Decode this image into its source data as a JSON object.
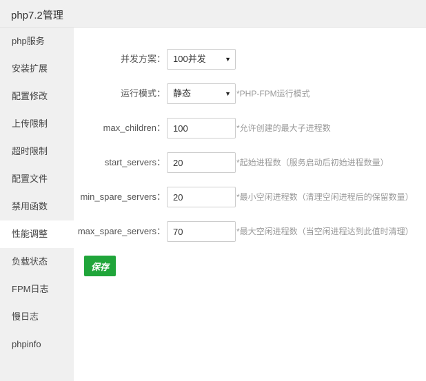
{
  "window": {
    "title": "php7.2管理"
  },
  "sidebar": {
    "items": [
      {
        "label": "php服务"
      },
      {
        "label": "安装扩展"
      },
      {
        "label": "配置修改"
      },
      {
        "label": "上传限制"
      },
      {
        "label": "超时限制"
      },
      {
        "label": "配置文件"
      },
      {
        "label": "禁用函数"
      },
      {
        "label": "性能调整",
        "active": true
      },
      {
        "label": "负载状态"
      },
      {
        "label": "FPM日志"
      },
      {
        "label": "慢日志"
      },
      {
        "label": "phpinfo"
      }
    ]
  },
  "form": {
    "concurrency": {
      "label": "并发方案：",
      "value": "100并发"
    },
    "mode": {
      "label": "运行模式：",
      "value": "静态",
      "hint": "*PHP-FPM运行模式"
    },
    "max_children": {
      "label": "max_children：",
      "value": "100",
      "hint": "*允许创建的最大子进程数"
    },
    "start_servers": {
      "label": "start_servers：",
      "value": "20",
      "hint": "*起始进程数（服务启动后初始进程数量）"
    },
    "min_spare_servers": {
      "label": "min_spare_servers：",
      "value": "20",
      "hint": "*最小空闲进程数（清理空闲进程后的保留数量）"
    },
    "max_spare_servers": {
      "label": "max_spare_servers：",
      "value": "70",
      "hint": "*最大空闲进程数（当空闲进程达到此值时清理）"
    },
    "save_label": "保存"
  },
  "colors": {
    "accent": "#20a53a",
    "sidebar_bg": "#f0f0f0",
    "hint": "#999999"
  }
}
